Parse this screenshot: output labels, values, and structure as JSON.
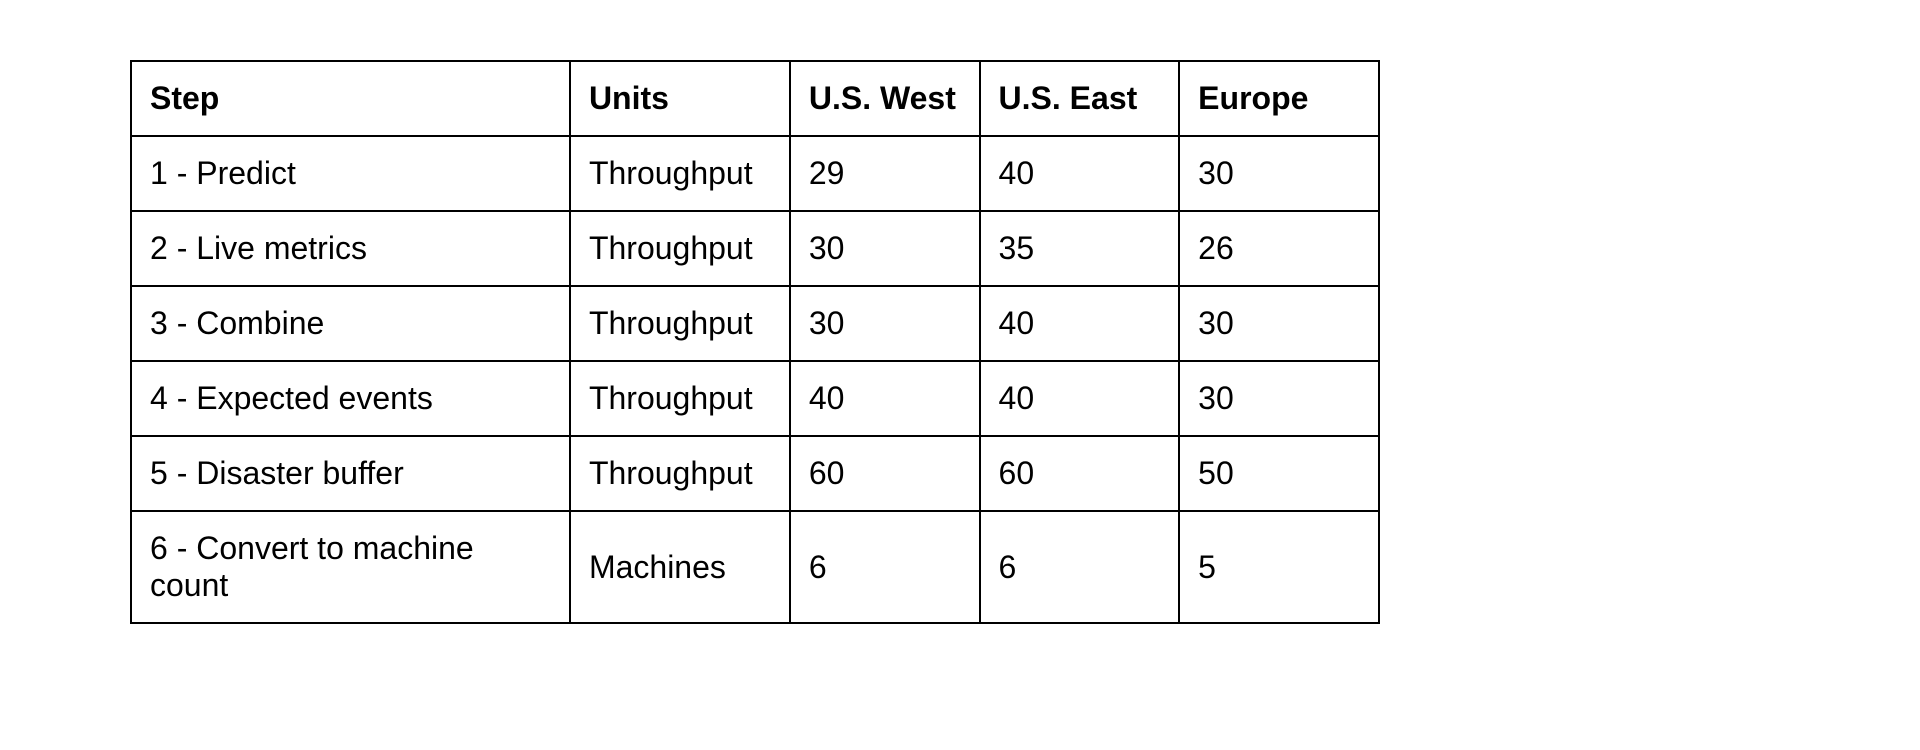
{
  "chart_data": {
    "type": "table",
    "columns": [
      "Step",
      "Units",
      "U.S. West",
      "U.S. East",
      "Europe"
    ],
    "rows": [
      {
        "step": "1 - Predict",
        "units": "Throughput",
        "us_west": "29",
        "us_east": "40",
        "europe": "30"
      },
      {
        "step": "2 - Live metrics",
        "units": "Throughput",
        "us_west": "30",
        "us_east": "35",
        "europe": "26"
      },
      {
        "step": "3 - Combine",
        "units": "Throughput",
        "us_west": "30",
        "us_east": "40",
        "europe": "30"
      },
      {
        "step": "4 - Expected events",
        "units": "Throughput",
        "us_west": "40",
        "us_east": "40",
        "europe": "30"
      },
      {
        "step": "5 - Disaster buffer",
        "units": "Throughput",
        "us_west": "60",
        "us_east": "60",
        "europe": "50"
      },
      {
        "step": "6 - Convert to machine count",
        "units": "Machines",
        "us_west": "6",
        "us_east": "6",
        "europe": "5"
      }
    ]
  }
}
